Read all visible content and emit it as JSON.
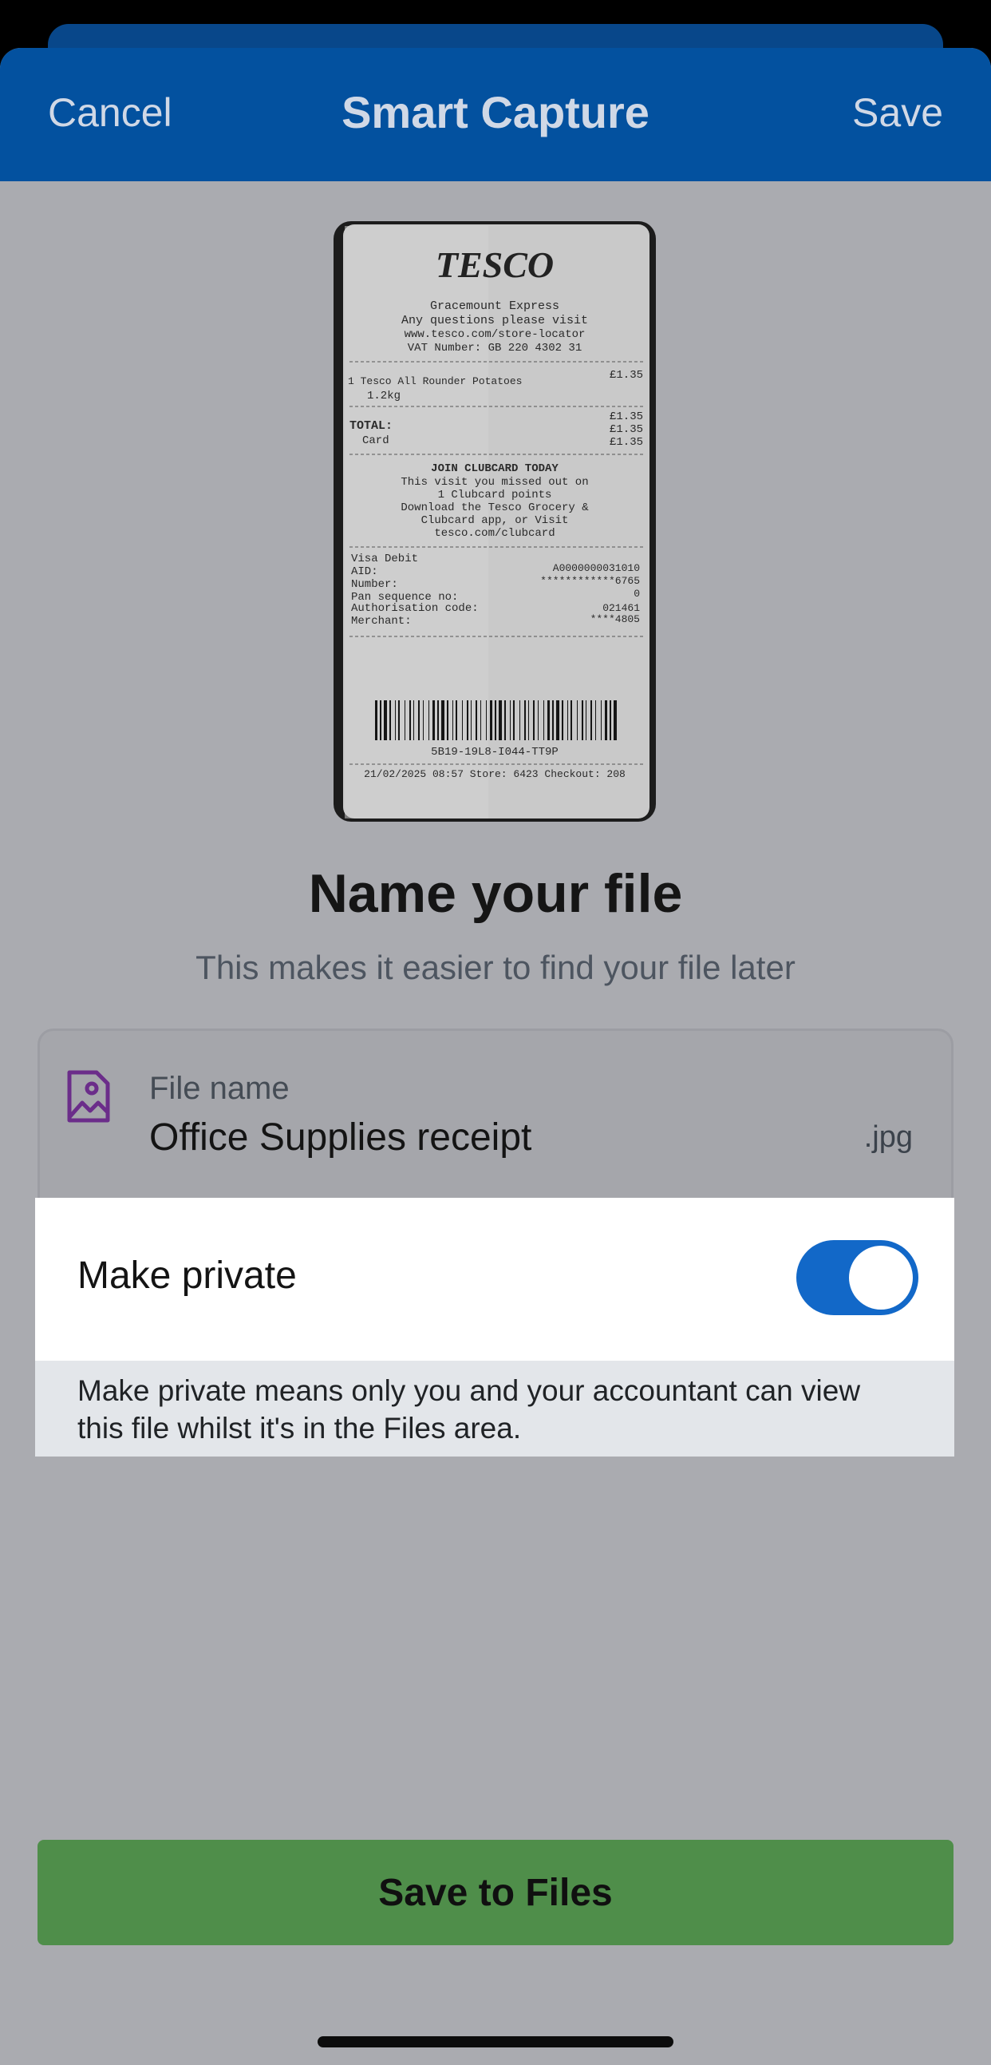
{
  "nav": {
    "cancel_label": "Cancel",
    "title": "Smart Capture",
    "save_label": "Save"
  },
  "receipt": {
    "store": "TESCO",
    "branch": "Gracemount Express",
    "question": "Any questions please visit",
    "url": "www.tesco.com/store-locator",
    "vat": "VAT Number: GB 220 4302 31",
    "item_line": "1  Tesco All Rounder Potatoes",
    "item_price": "£1.35",
    "item_weight": "1.2kg",
    "subtotal": "£1.35",
    "total_label": "TOTAL:",
    "total_value": "£1.35",
    "card_label": "Card",
    "card_value": "£1.35",
    "clubcard_title": "JOIN CLUBCARD TODAY",
    "clubcard_lines": [
      "This visit you missed out on",
      "1 Clubcard points",
      "Download the Tesco Grocery &",
      "Clubcard app, or Visit",
      "tesco.com/clubcard"
    ],
    "payment_rows": [
      {
        "label": "Visa Debit",
        "value": ""
      },
      {
        "label": "AID:",
        "value": "A0000000031010"
      },
      {
        "label": "Number:",
        "value": "************6765"
      },
      {
        "label": "Pan sequence no:",
        "value": "0"
      },
      {
        "label": "Authorisation code:",
        "value": "021461"
      },
      {
        "label": "Merchant:",
        "value": "****4805"
      }
    ],
    "barcode_text": "5B19-19L8-I044-TT9P",
    "footer": "21/02/2025 08:57 Store: 6423 Checkout: 208"
  },
  "heading": "Name your file",
  "subheading": "This makes it easier to find your file later",
  "file": {
    "icon": "file-image-icon",
    "label": "File name",
    "value": "Office Supplies receipt",
    "extension": ".jpg"
  },
  "private": {
    "label": "Make private",
    "enabled": true,
    "note": "Make private means only you and your accountant can view this file whilst it's in the Files area."
  },
  "save_files_label": "Save to Files",
  "colors": {
    "nav_bar": "#03519f",
    "toggle_on": "#1268c8",
    "primary_button": "#4f8e4a",
    "icon_purple": "#6b2d8a"
  }
}
